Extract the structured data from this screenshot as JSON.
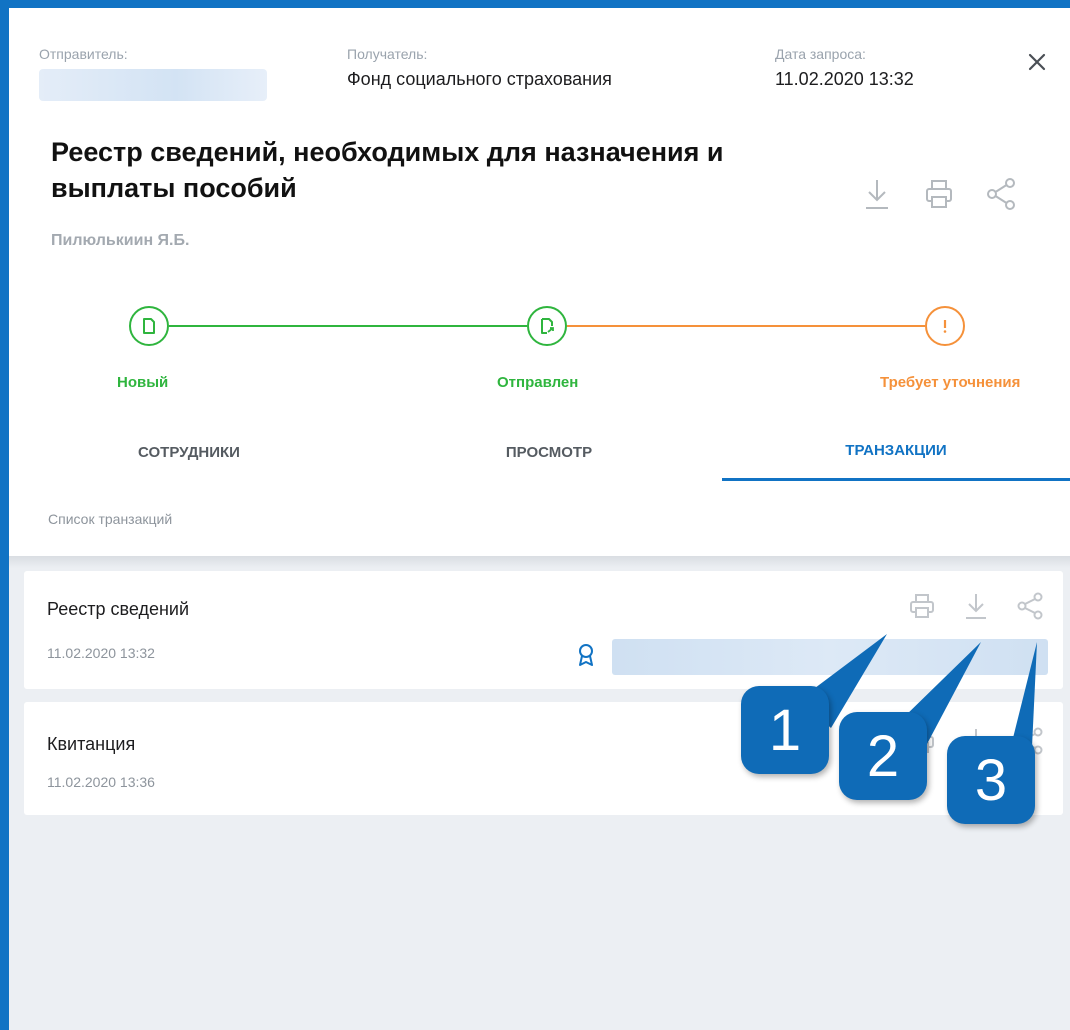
{
  "header": {
    "sender_label": "Отправитель:",
    "recipient_label": "Получатель:",
    "recipient_value": "Фонд социального страхования",
    "date_label": "Дата запроса:",
    "date_value": "11.02.2020 13:32",
    "title": "Реестр сведений, необходимых для назначения и выплаты пособий",
    "person": "Пилюлькиин Я.Б."
  },
  "icons": {
    "close": "close-icon",
    "download": "download-icon",
    "print": "print-icon",
    "share": "share-icon",
    "signature": "certificate-icon"
  },
  "progress": {
    "steps": [
      {
        "label": "Новый",
        "status": "done",
        "color": "#2fb53e"
      },
      {
        "label": "Отправлен",
        "status": "done",
        "color": "#2fb53e"
      },
      {
        "label": "Требует уточнения",
        "status": "warning",
        "color": "#f5913a"
      }
    ]
  },
  "tabs": [
    {
      "label": "СОТРУДНИКИ",
      "active": false
    },
    {
      "label": "ПРОСМОТР",
      "active": false
    },
    {
      "label": "ТРАНЗАКЦИИ",
      "active": true
    }
  ],
  "transactions": {
    "section_label": "Список транзакций",
    "items": [
      {
        "name": "Реестр сведений",
        "date": "11.02.2020 13:32"
      },
      {
        "name": "Квитанция",
        "date": "11.02.2020 13:36"
      }
    ]
  },
  "callouts": [
    "1",
    "2",
    "3"
  ],
  "colors": {
    "accent": "#1173c4",
    "success": "#2fb53e",
    "warning": "#f5913a",
    "callout": "#0f6bb7"
  }
}
